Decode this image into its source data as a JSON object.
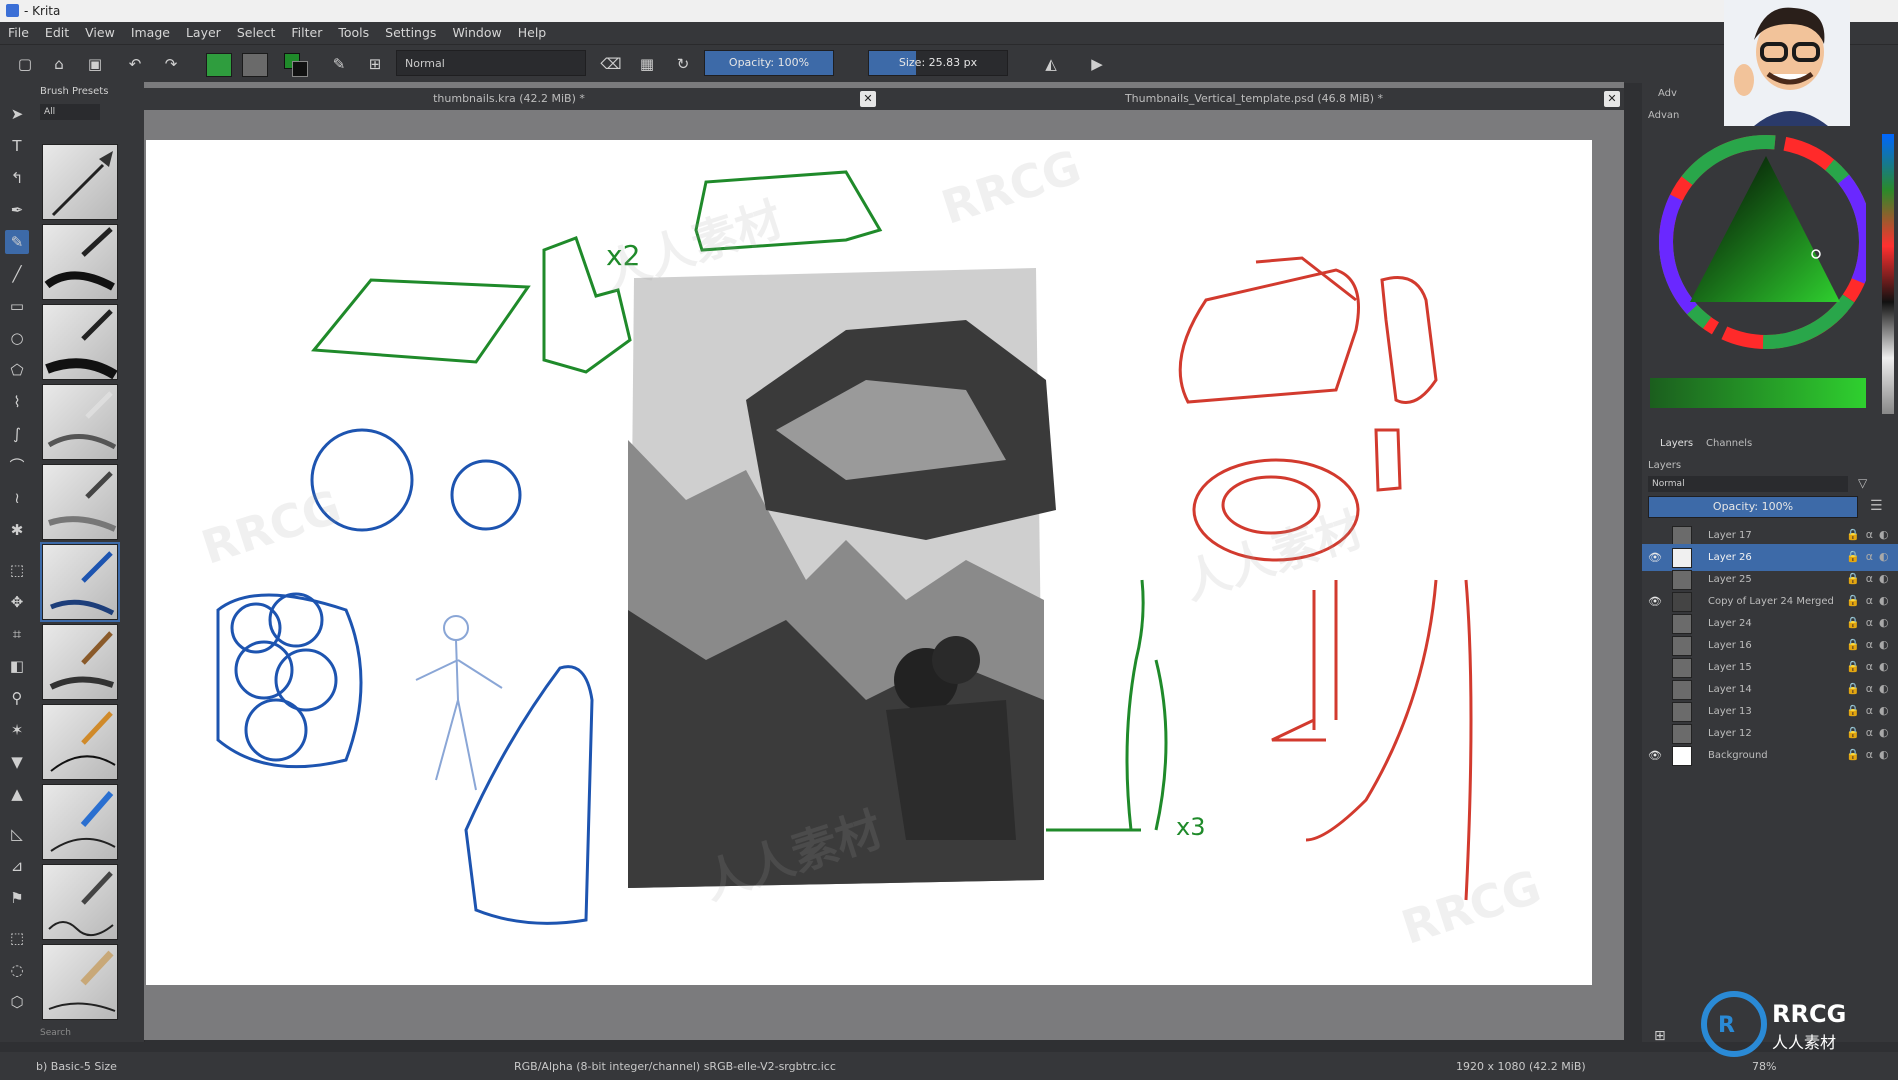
{
  "window": {
    "title": "- Krita"
  },
  "menu": [
    "File",
    "Edit",
    "View",
    "Image",
    "Layer",
    "Select",
    "Filter",
    "Tools",
    "Settings",
    "Window",
    "Help"
  ],
  "toolbar": {
    "blend_mode": "Normal",
    "opacity_label": "Opacity:  100%",
    "opacity_value": 1.0,
    "size_label": "Size:  25.83 px"
  },
  "brush_presets": {
    "title": "Brush Presets",
    "filter": "All",
    "search_placeholder": "Search"
  },
  "tabs": [
    {
      "label": "thumbnails.kra (42.2 MiB) *"
    },
    {
      "label": "Thumbnails_Vertical_template.psd (46.8 MiB) *"
    }
  ],
  "right_dock": {
    "tab_advanced": "Adv",
    "tab_advanced2": "Advan",
    "layers_tab": "Layers",
    "channels_tab": "Channels",
    "layers_title": "Layers",
    "blend_mode": "Normal",
    "opacity_label": "Opacity:  100%",
    "layers": [
      {
        "name": "Layer 17",
        "visible": false,
        "selected": false,
        "thumb": "#6b6b6b"
      },
      {
        "name": "Layer 26",
        "visible": true,
        "selected": true,
        "thumb": "#f0f0f0"
      },
      {
        "name": "Layer 25",
        "visible": false,
        "selected": false,
        "thumb": "#6b6b6b"
      },
      {
        "name": "Copy of Layer 24 Merged",
        "visible": true,
        "selected": false,
        "thumb": "#444444"
      },
      {
        "name": "Layer 24",
        "visible": false,
        "selected": false,
        "thumb": "#6b6b6b"
      },
      {
        "name": "Layer 16",
        "visible": false,
        "selected": false,
        "thumb": "#6b6b6b"
      },
      {
        "name": "Layer 15",
        "visible": false,
        "selected": false,
        "thumb": "#6b6b6b"
      },
      {
        "name": "Layer 14",
        "visible": false,
        "selected": false,
        "thumb": "#6b6b6b"
      },
      {
        "name": "Layer 13",
        "visible": false,
        "selected": false,
        "thumb": "#6b6b6b"
      },
      {
        "name": "Layer 12",
        "visible": false,
        "selected": false,
        "thumb": "#6b6b6b"
      },
      {
        "name": "Background",
        "visible": true,
        "selected": false,
        "thumb": "#ffffff"
      }
    ]
  },
  "statusbar": {
    "brush": "b) Basic-5 Size",
    "color_profile": "RGB/Alpha (8-bit integer/channel)  sRGB-elle-V2-srgbtrc.icc",
    "dimensions": "1920 x 1080 (42.2 MiB)",
    "zoom": "78%"
  },
  "watermark": {
    "brand": "RRCG",
    "cn": "人人素材"
  },
  "colors": {
    "accent": "#3d6aa8",
    "sketch_green": "#1f8a2a",
    "sketch_blue": "#1d54b0",
    "sketch_red": "#d23a2e"
  }
}
